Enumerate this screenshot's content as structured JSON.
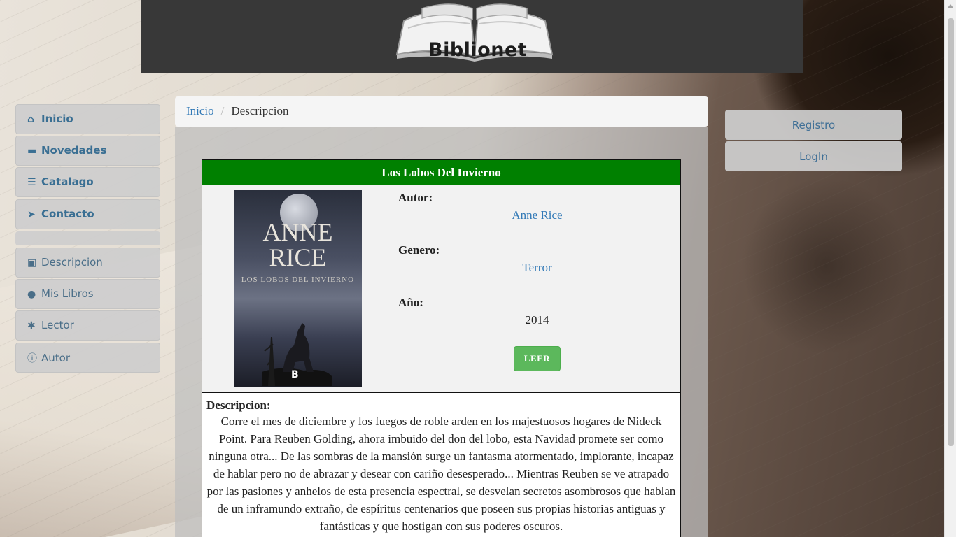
{
  "site": {
    "logo_text": "Biblionet"
  },
  "sidebar": {
    "items": [
      {
        "label": "Inicio",
        "icon": "home-icon"
      },
      {
        "label": "Novedades",
        "icon": "comment-icon"
      },
      {
        "label": "Catalago",
        "icon": "list-icon"
      },
      {
        "label": "Contacto",
        "icon": "send-icon"
      },
      {
        "label": "Descripcion",
        "icon": "picture-icon"
      },
      {
        "label": "Mis Libros",
        "icon": "user-icon"
      },
      {
        "label": "Lector",
        "icon": "asterisk-icon"
      },
      {
        "label": "Autor",
        "icon": "info-icon"
      }
    ]
  },
  "account": {
    "register_label": "Registro",
    "login_label": "LogIn"
  },
  "breadcrumb": {
    "home": "Inicio",
    "current": "Descripcion"
  },
  "book": {
    "title": "Los Lobos Del Invierno",
    "cover": {
      "author_line1": "ANNE",
      "author_line2": "RICE",
      "subtitle": "LOS LOBOS DEL INVIERNO",
      "publisher_mark": "B"
    },
    "author_label": "Autor:",
    "author": "Anne Rice",
    "genre_label": "Genero:",
    "genre": "Terror",
    "year_label": "Año:",
    "year": "2014",
    "read_label": "LEER",
    "description_label": "Descripcion:",
    "description": "Corre el mes de diciembre y los fuegos de roble arden en los majestuosos hogares de Nideck Point. Para Reuben Golding, ahora imbuido del don del lobo, esta Navidad promete ser como ninguna otra... De las sombras de la mansión surge un fantasma atormentado, implorante, incapaz de hablar pero no de abrazar y desear con cariño desesperado... Mientras Reuben se ve atrapado por las pasiones y anhelos de esta presencia espectral, se desvelan secretos asombrosos que hablan de un inframundo extraño, de espíritus centenarios que poseen sus propias historias antiguas y fantásticas y que hostigan con sus poderes oscuros."
  },
  "colors": {
    "header_bg": "#383838",
    "title_bar": "#008000",
    "read_button": "#5cb85c",
    "link": "#337ab7"
  }
}
